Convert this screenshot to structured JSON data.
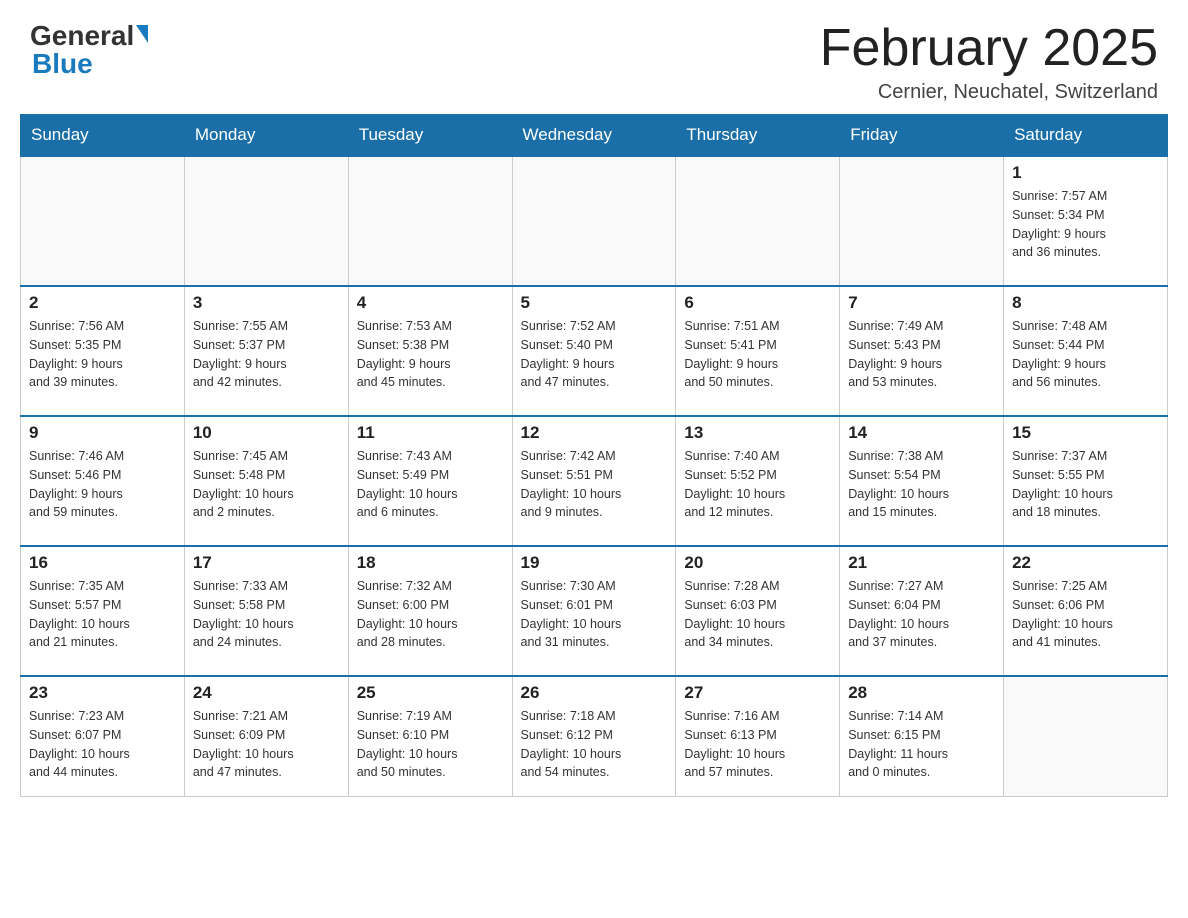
{
  "header": {
    "logo_general": "General",
    "logo_blue": "Blue",
    "month_title": "February 2025",
    "subtitle": "Cernier, Neuchatel, Switzerland"
  },
  "days_of_week": [
    "Sunday",
    "Monday",
    "Tuesday",
    "Wednesday",
    "Thursday",
    "Friday",
    "Saturday"
  ],
  "weeks": [
    [
      {
        "day": "",
        "info": ""
      },
      {
        "day": "",
        "info": ""
      },
      {
        "day": "",
        "info": ""
      },
      {
        "day": "",
        "info": ""
      },
      {
        "day": "",
        "info": ""
      },
      {
        "day": "",
        "info": ""
      },
      {
        "day": "1",
        "info": "Sunrise: 7:57 AM\nSunset: 5:34 PM\nDaylight: 9 hours\nand 36 minutes."
      }
    ],
    [
      {
        "day": "2",
        "info": "Sunrise: 7:56 AM\nSunset: 5:35 PM\nDaylight: 9 hours\nand 39 minutes."
      },
      {
        "day": "3",
        "info": "Sunrise: 7:55 AM\nSunset: 5:37 PM\nDaylight: 9 hours\nand 42 minutes."
      },
      {
        "day": "4",
        "info": "Sunrise: 7:53 AM\nSunset: 5:38 PM\nDaylight: 9 hours\nand 45 minutes."
      },
      {
        "day": "5",
        "info": "Sunrise: 7:52 AM\nSunset: 5:40 PM\nDaylight: 9 hours\nand 47 minutes."
      },
      {
        "day": "6",
        "info": "Sunrise: 7:51 AM\nSunset: 5:41 PM\nDaylight: 9 hours\nand 50 minutes."
      },
      {
        "day": "7",
        "info": "Sunrise: 7:49 AM\nSunset: 5:43 PM\nDaylight: 9 hours\nand 53 minutes."
      },
      {
        "day": "8",
        "info": "Sunrise: 7:48 AM\nSunset: 5:44 PM\nDaylight: 9 hours\nand 56 minutes."
      }
    ],
    [
      {
        "day": "9",
        "info": "Sunrise: 7:46 AM\nSunset: 5:46 PM\nDaylight: 9 hours\nand 59 minutes."
      },
      {
        "day": "10",
        "info": "Sunrise: 7:45 AM\nSunset: 5:48 PM\nDaylight: 10 hours\nand 2 minutes."
      },
      {
        "day": "11",
        "info": "Sunrise: 7:43 AM\nSunset: 5:49 PM\nDaylight: 10 hours\nand 6 minutes."
      },
      {
        "day": "12",
        "info": "Sunrise: 7:42 AM\nSunset: 5:51 PM\nDaylight: 10 hours\nand 9 minutes."
      },
      {
        "day": "13",
        "info": "Sunrise: 7:40 AM\nSunset: 5:52 PM\nDaylight: 10 hours\nand 12 minutes."
      },
      {
        "day": "14",
        "info": "Sunrise: 7:38 AM\nSunset: 5:54 PM\nDaylight: 10 hours\nand 15 minutes."
      },
      {
        "day": "15",
        "info": "Sunrise: 7:37 AM\nSunset: 5:55 PM\nDaylight: 10 hours\nand 18 minutes."
      }
    ],
    [
      {
        "day": "16",
        "info": "Sunrise: 7:35 AM\nSunset: 5:57 PM\nDaylight: 10 hours\nand 21 minutes."
      },
      {
        "day": "17",
        "info": "Sunrise: 7:33 AM\nSunset: 5:58 PM\nDaylight: 10 hours\nand 24 minutes."
      },
      {
        "day": "18",
        "info": "Sunrise: 7:32 AM\nSunset: 6:00 PM\nDaylight: 10 hours\nand 28 minutes."
      },
      {
        "day": "19",
        "info": "Sunrise: 7:30 AM\nSunset: 6:01 PM\nDaylight: 10 hours\nand 31 minutes."
      },
      {
        "day": "20",
        "info": "Sunrise: 7:28 AM\nSunset: 6:03 PM\nDaylight: 10 hours\nand 34 minutes."
      },
      {
        "day": "21",
        "info": "Sunrise: 7:27 AM\nSunset: 6:04 PM\nDaylight: 10 hours\nand 37 minutes."
      },
      {
        "day": "22",
        "info": "Sunrise: 7:25 AM\nSunset: 6:06 PM\nDaylight: 10 hours\nand 41 minutes."
      }
    ],
    [
      {
        "day": "23",
        "info": "Sunrise: 7:23 AM\nSunset: 6:07 PM\nDaylight: 10 hours\nand 44 minutes."
      },
      {
        "day": "24",
        "info": "Sunrise: 7:21 AM\nSunset: 6:09 PM\nDaylight: 10 hours\nand 47 minutes."
      },
      {
        "day": "25",
        "info": "Sunrise: 7:19 AM\nSunset: 6:10 PM\nDaylight: 10 hours\nand 50 minutes."
      },
      {
        "day": "26",
        "info": "Sunrise: 7:18 AM\nSunset: 6:12 PM\nDaylight: 10 hours\nand 54 minutes."
      },
      {
        "day": "27",
        "info": "Sunrise: 7:16 AM\nSunset: 6:13 PM\nDaylight: 10 hours\nand 57 minutes."
      },
      {
        "day": "28",
        "info": "Sunrise: 7:14 AM\nSunset: 6:15 PM\nDaylight: 11 hours\nand 0 minutes."
      },
      {
        "day": "",
        "info": ""
      }
    ]
  ]
}
